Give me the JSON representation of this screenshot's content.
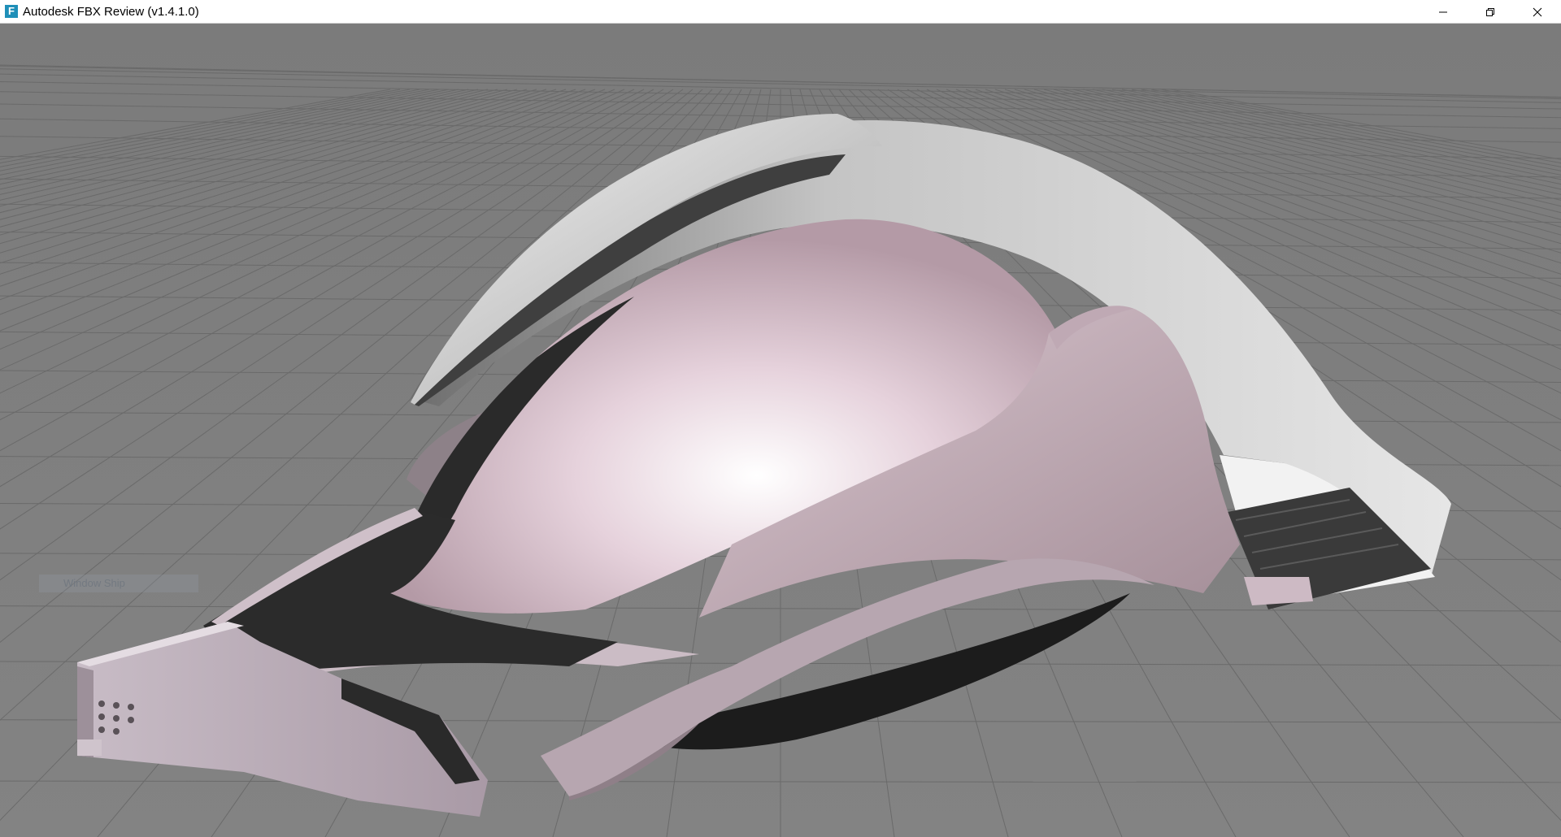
{
  "window": {
    "title": "Autodesk FBX Review (v1.4.1.0)",
    "icon": "fbx-app-icon",
    "icon_glyph": "F"
  },
  "controls": {
    "minimize": "minimize-icon",
    "restore": "restore-icon",
    "close": "close-icon"
  },
  "viewport": {
    "overlay_label": "Window Ship",
    "background_color": "#7c7c7c",
    "grid_color": "#6a6a6a",
    "model_primary_color": "#c9b3bd",
    "model_secondary_color": "#d8d8d8",
    "model_dark_color": "#2a2a2a"
  }
}
